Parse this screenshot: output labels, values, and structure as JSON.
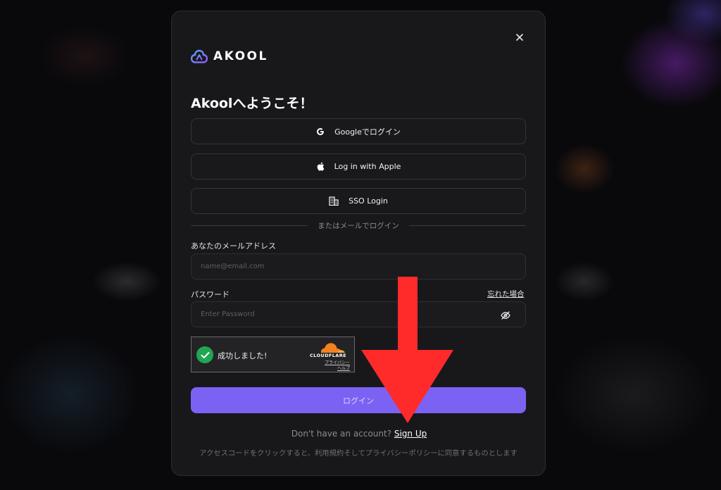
{
  "modal": {
    "logo_text": "AKOOL",
    "title": "Akoolへようこそ！",
    "close_icon": "close-icon"
  },
  "social": {
    "google_label": "Googleでログイン",
    "apple_label": "Log in with Apple",
    "sso_label": "SSO Login"
  },
  "divider_text": "またはメールでログイン",
  "email": {
    "label": "あなたのメールアドレス",
    "placeholder": "name@email.com",
    "value": ""
  },
  "password": {
    "label": "パスワード",
    "placeholder": "Enter Password",
    "forgot_label": "忘れた場合",
    "toggle_icon": "eye-off-icon"
  },
  "captcha": {
    "status_text": "成功しました!",
    "brand": "CLOUDFLARE",
    "privacy_link": "プライバシー",
    "help_link": "ヘルプ"
  },
  "login_label": "ログイン",
  "signup": {
    "prompt": "Don't have an account?",
    "link": "Sign Up"
  },
  "terms_text": "アクセスコードをクリックすると、利用規約そしてプライバシーポリシーに同意するものとします",
  "colors": {
    "accent": "#7b62f2",
    "success": "#21a652",
    "cloudflare": "#f48120",
    "annotation_arrow": "#ff2b2b"
  }
}
